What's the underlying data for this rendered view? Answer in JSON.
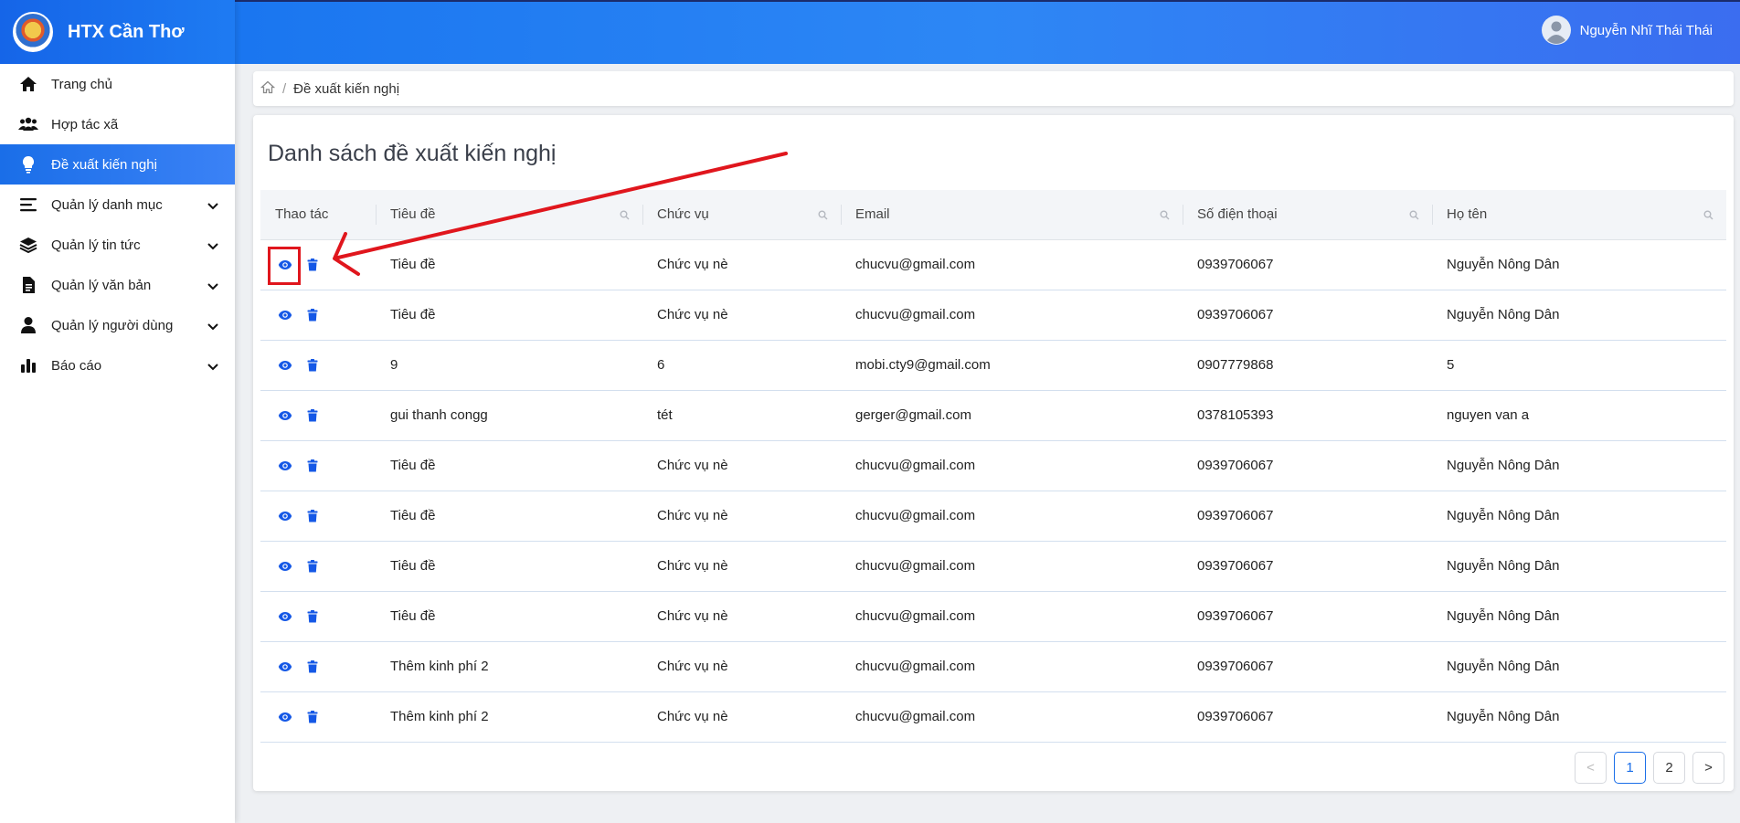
{
  "brand": {
    "name": "HTX Cần Thơ"
  },
  "user": {
    "name": "Nguyễn Nhĩ Thái Thái"
  },
  "sidebar": {
    "items": [
      {
        "label": "Trang chủ",
        "icon": "home-icon"
      },
      {
        "label": "Hợp tác xã",
        "icon": "users-icon"
      },
      {
        "label": "Đề xuất kiến nghị",
        "icon": "lightbulb-icon",
        "active": true
      },
      {
        "label": "Quản lý danh mục",
        "icon": "list-icon",
        "expandable": true
      },
      {
        "label": "Quản lý tin tức",
        "icon": "layers-icon",
        "expandable": true
      },
      {
        "label": "Quản lý văn bản",
        "icon": "document-icon",
        "expandable": true
      },
      {
        "label": "Quản lý người dùng",
        "icon": "user-icon",
        "expandable": true
      },
      {
        "label": "Báo cáo",
        "icon": "bar-chart-icon",
        "expandable": true
      }
    ]
  },
  "breadcrumb": {
    "current": "Đề xuất kiến nghị"
  },
  "main": {
    "title": "Danh sách đề xuất kiến nghị",
    "table": {
      "columns": [
        "Thao tác",
        "Tiêu đề",
        "Chức vụ",
        "Email",
        "Số điện thoại",
        "Họ tên"
      ],
      "rows": [
        [
          "Tiêu đề",
          "Chức vụ nè",
          "chucvu@gmail.com",
          "0939706067",
          "Nguyễn Nông Dân"
        ],
        [
          "Tiêu đề",
          "Chức vụ nè",
          "chucvu@gmail.com",
          "0939706067",
          "Nguyễn Nông Dân"
        ],
        [
          "9",
          "6",
          "mobi.cty9@gmail.com",
          "0907779868",
          "5"
        ],
        [
          "gui thanh congg",
          "tét",
          "gerger@gmail.com",
          "0378105393",
          "nguyen van a"
        ],
        [
          "Tiêu đề",
          "Chức vụ nè",
          "chucvu@gmail.com",
          "0939706067",
          "Nguyễn Nông Dân"
        ],
        [
          "Tiêu đề",
          "Chức vụ nè",
          "chucvu@gmail.com",
          "0939706067",
          "Nguyễn Nông Dân"
        ],
        [
          "Tiêu đề",
          "Chức vụ nè",
          "chucvu@gmail.com",
          "0939706067",
          "Nguyễn Nông Dân"
        ],
        [
          "Tiêu đề",
          "Chức vụ nè",
          "chucvu@gmail.com",
          "0939706067",
          "Nguyễn Nông Dân"
        ],
        [
          "Thêm kinh phí 2",
          "Chức vụ nè",
          "chucvu@gmail.com",
          "0939706067",
          "Nguyễn Nông Dân"
        ],
        [
          "Thêm kinh phí 2",
          "Chức vụ nè",
          "chucvu@gmail.com",
          "0939706067",
          "Nguyễn Nông Dân"
        ]
      ]
    },
    "pagination": {
      "prev": "<",
      "pages": [
        "1",
        "2"
      ],
      "current": "1",
      "next": ">"
    }
  },
  "colors": {
    "accent": "#1a6ee8",
    "action_icon": "#1558e6",
    "annotation": "#e0161d"
  }
}
